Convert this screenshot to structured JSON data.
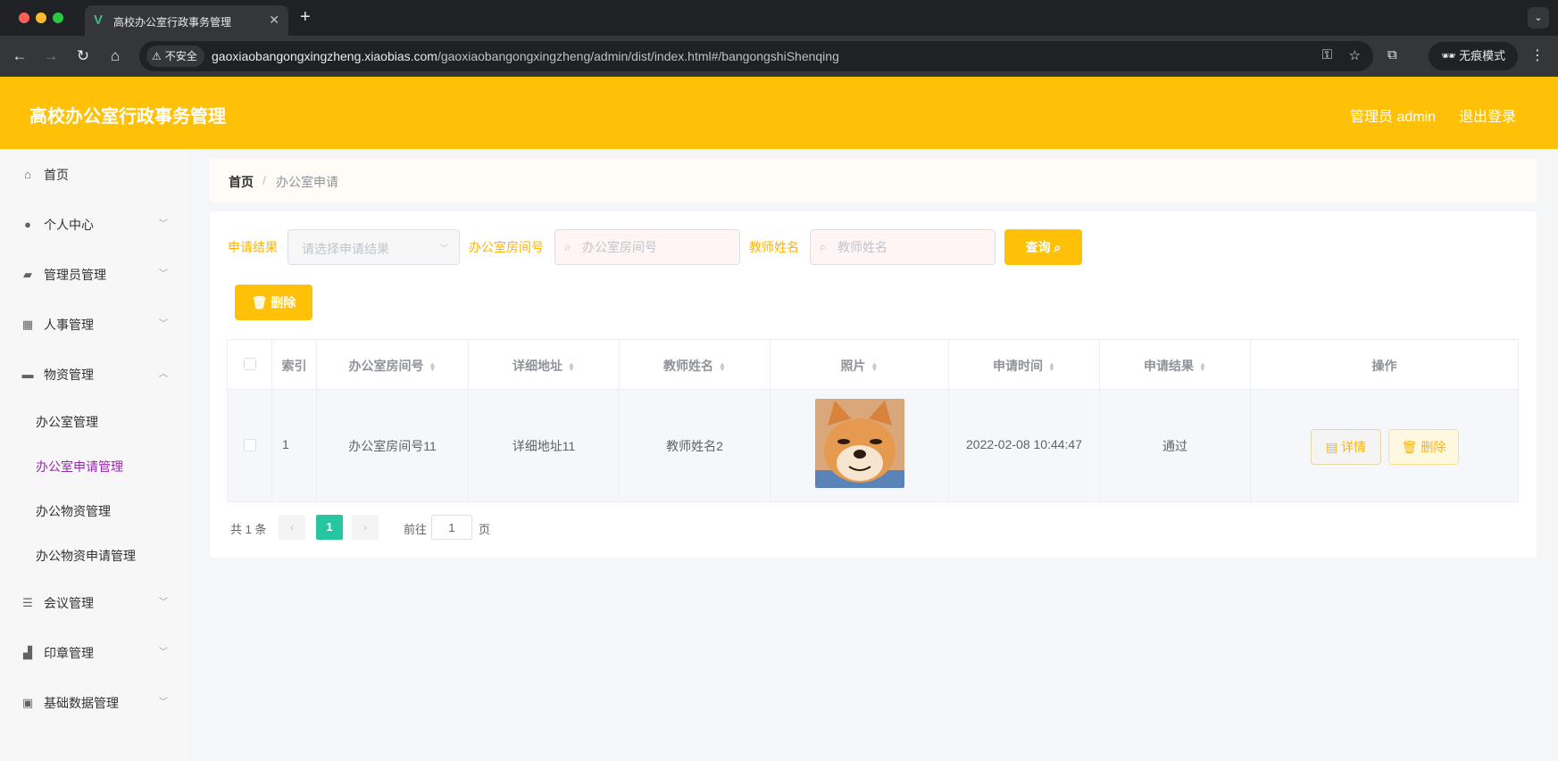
{
  "browser": {
    "tab_title": "高校办公室行政事务管理",
    "insecure_label": "不安全",
    "url_host": "gaoxiaobangongxingzheng.xiaobias.com",
    "url_path": "/gaoxiaobangongxingzheng/admin/dist/index.html#/bangongshiShenqing",
    "incognito_label": "无痕模式"
  },
  "header": {
    "title": "高校办公室行政事务管理",
    "user": "管理员 admin",
    "logout": "退出登录"
  },
  "sidebar": {
    "items": [
      {
        "label": "首页",
        "icon": "home-icon"
      },
      {
        "label": "个人中心",
        "icon": "user-icon"
      },
      {
        "label": "管理员管理",
        "icon": "ticket-icon"
      },
      {
        "label": "人事管理",
        "icon": "grid-icon"
      },
      {
        "label": "物资管理",
        "icon": "chat-icon"
      },
      {
        "label": "会议管理",
        "icon": "list-icon"
      },
      {
        "label": "印章管理",
        "icon": "stamp-icon"
      },
      {
        "label": "基础数据管理",
        "icon": "clipboard-icon"
      }
    ],
    "sub_items": [
      "办公室管理",
      "办公室申请管理",
      "办公物资管理",
      "办公物资申请管理"
    ],
    "active_sub": "办公室申请管理"
  },
  "breadcrumb": {
    "home": "首页",
    "separator": "/",
    "current": "办公室申请"
  },
  "filters": {
    "result_label": "申请结果",
    "result_placeholder": "请选择申请结果",
    "room_label": "办公室房间号",
    "room_placeholder": "办公室房间号",
    "teacher_label": "教师姓名",
    "teacher_placeholder": "教师姓名",
    "query_button": "查询"
  },
  "toolbar": {
    "delete_button": "删除"
  },
  "table": {
    "headers": [
      "索引",
      "办公室房间号",
      "详细地址",
      "教师姓名",
      "照片",
      "申请时间",
      "申请结果",
      "操作"
    ],
    "rows": [
      {
        "index": "1",
        "room": "办公室房间号11",
        "address": "详细地址11",
        "teacher": "教师姓名2",
        "time": "2022-02-08 10:44:47",
        "result": "通过",
        "detail_button": "详情",
        "delete_button": "删除"
      }
    ]
  },
  "pagination": {
    "total": "共 1 条",
    "current_page": "1",
    "goto_label": "前往",
    "goto_value": "1",
    "page_unit": "页"
  },
  "colors": {
    "accent": "#ffc107",
    "active_menu": "#9c27b0",
    "page_active": "#26c6a0"
  }
}
